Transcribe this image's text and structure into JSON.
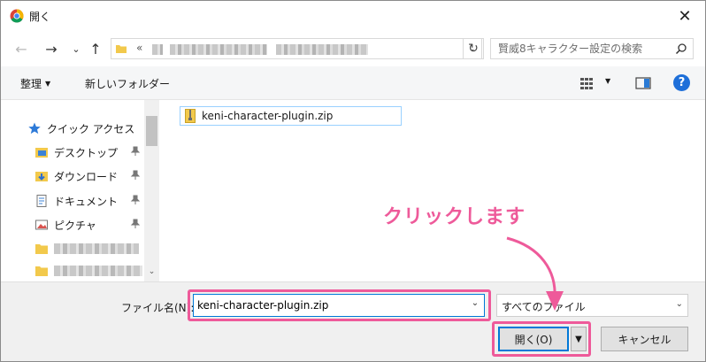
{
  "window": {
    "title": "開く",
    "close_glyph": "✕"
  },
  "address": {
    "back_glyph": "←",
    "forward_glyph": "→",
    "recent_glyph": "⌄",
    "up_glyph": "↑",
    "chevrons": "«",
    "dropdown_glyph": "⌄",
    "refresh_glyph": "↻"
  },
  "search": {
    "placeholder": "賢威8キャラクター設定の検索"
  },
  "toolbar": {
    "organize_label": "整理",
    "organize_caret": "▼",
    "new_folder_label": "新しいフォルダー",
    "view_caret": "▼",
    "help_label": "?"
  },
  "nav": {
    "items": [
      {
        "label": "クイック アクセス",
        "icon": "star-icon"
      },
      {
        "label": "デスクトップ",
        "icon": "desktop-folder-icon"
      },
      {
        "label": "ダウンロード",
        "icon": "download-folder-icon"
      },
      {
        "label": "ドキュメント",
        "icon": "documents-icon"
      },
      {
        "label": "ピクチャ",
        "icon": "pictures-icon"
      }
    ],
    "scroll_down_glyph": "⌄"
  },
  "files": [
    {
      "name": "keni-character-plugin.zip",
      "icon": "zip-folder-icon"
    }
  ],
  "annotation": {
    "text": "クリックします",
    "color": "#ee5a9a"
  },
  "footer": {
    "filename_label": "ファイル名(N):",
    "filename_value": "keni-character-plugin.zip",
    "filename_dd": "⌄",
    "filter_value": "すべてのファイル",
    "filter_dd": "⌄",
    "open_label": "開く(O)",
    "open_split_glyph": "▼",
    "cancel_label": "キャンセル"
  },
  "colors": {
    "accent": "#0078d7",
    "highlight": "#ee5a9a",
    "help": "#1e6fd9"
  }
}
